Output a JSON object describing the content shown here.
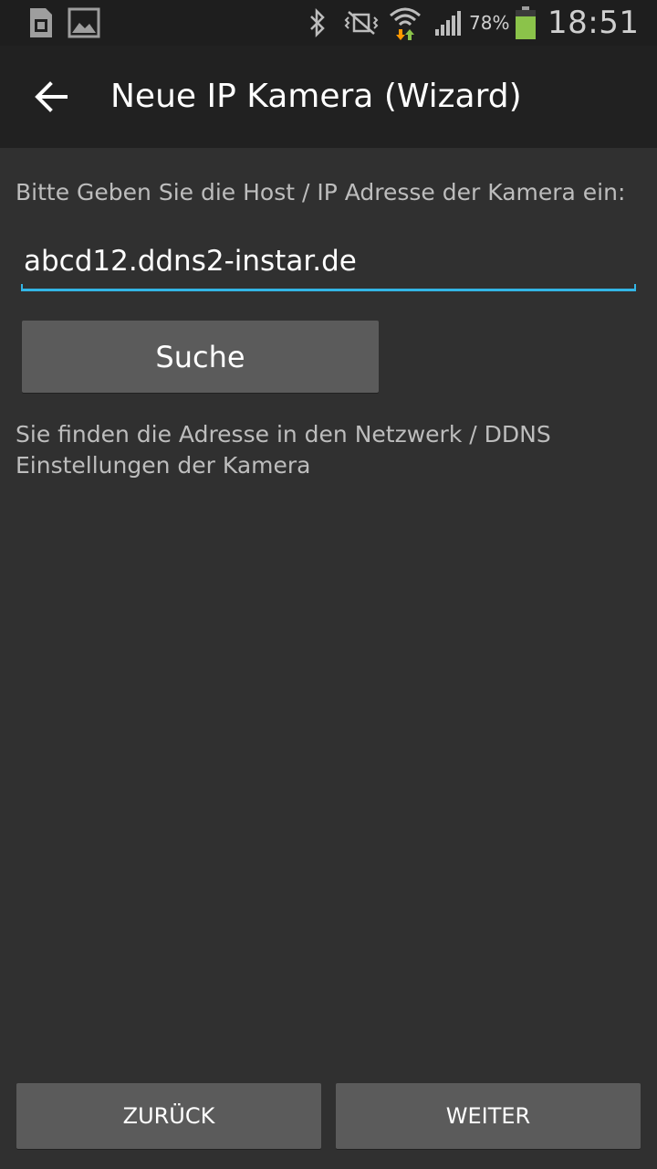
{
  "status_bar": {
    "icons": [
      "sim-card-icon",
      "image-icon",
      "bluetooth-icon",
      "vibrate-icon",
      "wifi-icon",
      "signal-icon",
      "battery-icon"
    ],
    "battery_percent": "78%",
    "time": "18:51",
    "battery_color": "#8bc34a"
  },
  "action_bar": {
    "title": "Neue IP Kamera (Wizard)"
  },
  "form": {
    "prompt": "Bitte Geben Sie die Host / IP Adresse der Kamera ein:",
    "host_value": "abcd12.ddns2-instar.de",
    "search_label": "Suche",
    "hint_line1": "Sie finden die Adresse in den Netzwerk / DDNS",
    "hint_line2": "Einstellungen der Kamera"
  },
  "footer": {
    "back_label": "ZURÜCK",
    "next_label": "WEITER"
  },
  "colors": {
    "accent": "#33b5e5",
    "background": "#303030",
    "action_bar": "#212121",
    "button": "#5b5b5b"
  }
}
